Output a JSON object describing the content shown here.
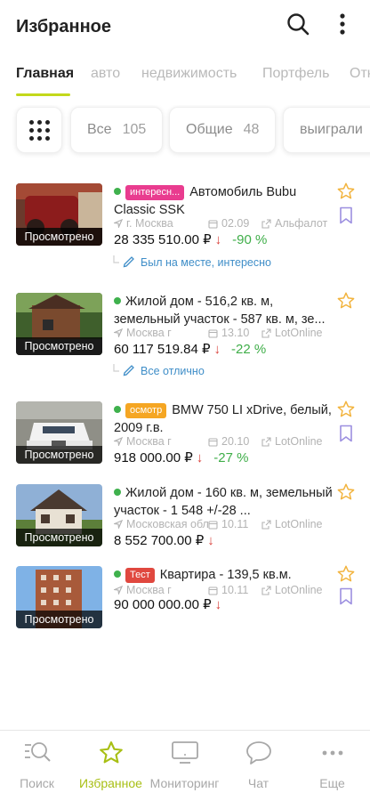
{
  "header": {
    "title": "Избранное"
  },
  "tabs": [
    {
      "label": "Главная"
    },
    {
      "label": "авто"
    },
    {
      "label": "недвижимость"
    },
    {
      "label": "Портфель"
    },
    {
      "label": "Отк"
    }
  ],
  "chips": [
    {
      "label": "Все",
      "count": "105"
    },
    {
      "label": "Общие",
      "count": "48"
    },
    {
      "label": "выиграли",
      "count": ""
    }
  ],
  "items": [
    {
      "badge": "интересн...",
      "badge_color": "#e93c8f",
      "title": "Автомобиль Bubu Classic SSK",
      "location": "г. Москва",
      "date": "02.09",
      "source": "Альфалот",
      "price": "28 335 510.00 ₽",
      "arrow": "↓",
      "percent": "-90 %",
      "thumb_label": "Просмотрено",
      "note": "Был на месте, интересно"
    },
    {
      "badge": "",
      "title": "Жилой дом - 516,2 кв. м, земельный участок - 587 кв. м, зе...",
      "location": "Москва г",
      "date": "13.10",
      "source": "LotOnline",
      "price": "60 117 519.84 ₽",
      "arrow": "↓",
      "percent": "-22 %",
      "thumb_label": "Просмотрено",
      "note": "Все отлично"
    },
    {
      "badge": "осмотр",
      "badge_color": "#f5a623",
      "title": "BMW 750 LI xDrive, белый, 2009 г.в.",
      "location": "Москва г",
      "date": "20.10",
      "source": "LotOnline",
      "price": "918 000.00 ₽",
      "arrow": "↓",
      "percent": "-27 %",
      "thumb_label": "Просмотрено",
      "note": ""
    },
    {
      "badge": "",
      "title": "Жилой дом - 160 кв. м, земельный участок - 1 548 +/-28 ...",
      "location": "Московская обл",
      "date": "10.11",
      "source": "LotOnline",
      "price": "8 552 700.00 ₽",
      "arrow": "↓",
      "percent": "",
      "thumb_label": "Просмотрено",
      "note": ""
    },
    {
      "badge": "Тест",
      "badge_color": "#e0483f",
      "title": "Квартира - 139,5 кв.м.",
      "location": "Москва г",
      "date": "10.11",
      "source": "LotOnline",
      "price": "90 000 000.00 ₽",
      "arrow": "↓",
      "percent": "",
      "thumb_label": "Просмотрено",
      "note": ""
    }
  ],
  "bottom_nav": [
    {
      "label": "Поиск",
      "icon": "search-list-icon"
    },
    {
      "label": "Избранное",
      "icon": "star-icon"
    },
    {
      "label": "Мониторинг",
      "icon": "monitor-icon"
    },
    {
      "label": "Чат",
      "icon": "chat-icon"
    },
    {
      "label": "Еще",
      "icon": "more-horizontal-icon"
    }
  ],
  "colors": {
    "accent": "#c3d81b",
    "active_nav": "#a8bf14",
    "star": "#f2b33d",
    "bookmark": "#9c8fe0",
    "link": "#3f8ec8"
  }
}
